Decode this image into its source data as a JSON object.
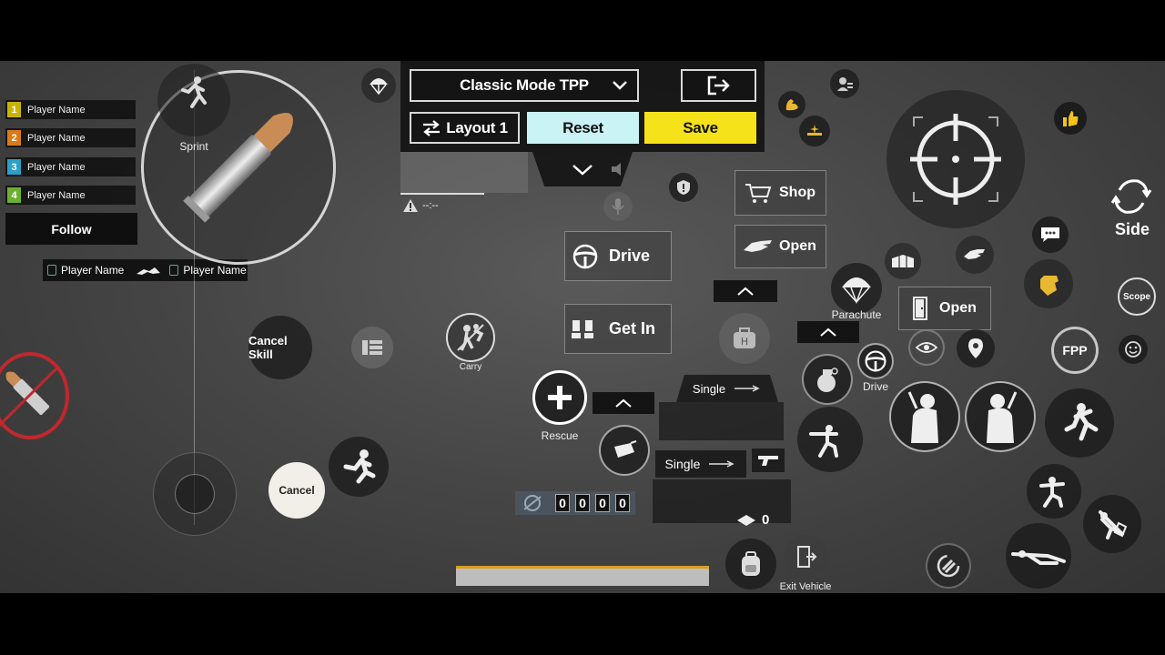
{
  "team": {
    "members": [
      {
        "num": "1",
        "name": "Player Name",
        "color": "#c8b400"
      },
      {
        "num": "2",
        "name": "Player Name",
        "color": "#d97a1a"
      },
      {
        "num": "3",
        "name": "Player Name",
        "color": "#2aa0c8"
      },
      {
        "num": "4",
        "name": "Player Name",
        "color": "#6cb030"
      }
    ],
    "follow_label": "Follow",
    "kill_feed": {
      "killer": "Player Name",
      "victim": "Player Name"
    }
  },
  "left": {
    "sprint_label": "Sprint",
    "cancel_skill_label": "Cancel Skill",
    "cancel_label": "Cancel"
  },
  "toolbar": {
    "mode_label": "Classic Mode TPP",
    "layout_label": "Layout 1",
    "reset_label": "Reset",
    "save_label": "Save"
  },
  "minimap": {
    "ping_text": "--:--"
  },
  "center": {
    "carry_label": "Carry",
    "drive_label": "Drive",
    "get_in_label": "Get In",
    "rescue_label": "Rescue",
    "kill_counter": [
      "0",
      "0",
      "0",
      "0"
    ]
  },
  "weapons": {
    "slot1_mode": "Single",
    "slot2_mode": "Single",
    "ammo_count": "0"
  },
  "right": {
    "shop_label": "Shop",
    "open_label": "Open",
    "parachute_label": "Parachute",
    "door_open_label": "Open",
    "drive_label": "Drive",
    "side_label": "Side",
    "scope_label": "Scope",
    "fpp_label": "FPP",
    "exit_vehicle_label": "Exit Vehicle"
  },
  "colors": {
    "save_bg": "#f5e21a",
    "reset_bg": "#c9f3f5",
    "like_badge": "#f0c419",
    "skin_icon": "#e8b830",
    "health_bar": "#d9a020",
    "surrender_ring": "#c0282d"
  }
}
